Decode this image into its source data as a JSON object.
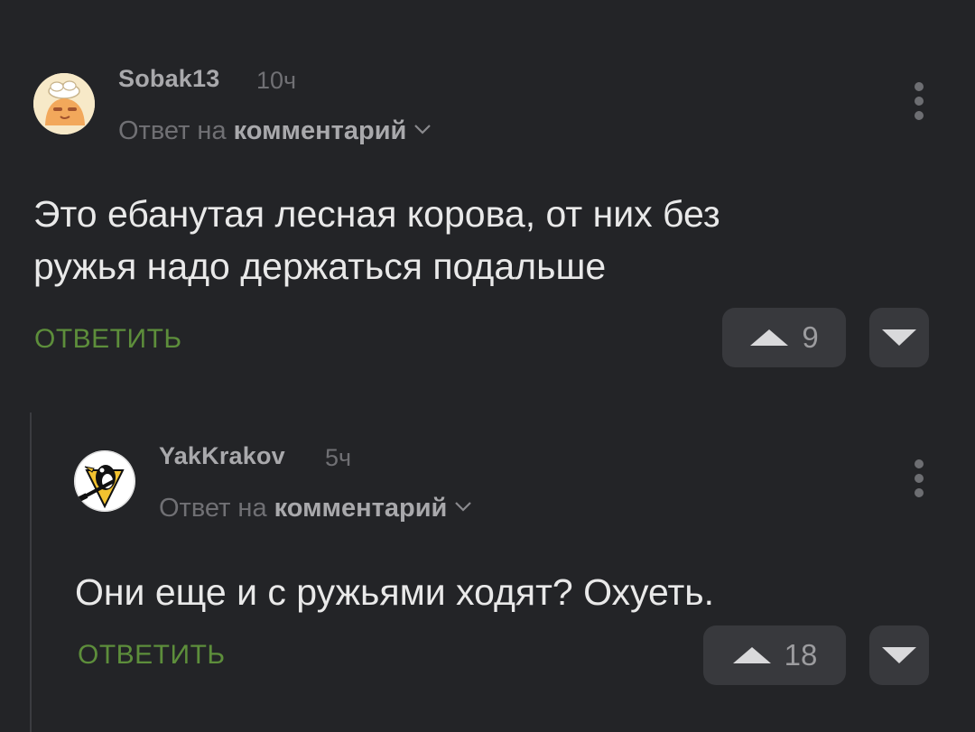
{
  "comments": [
    {
      "author": "Sobak13",
      "time": "10ч",
      "reply_to_prefix": "Ответ на",
      "reply_to_link": "комментарий",
      "text_line1": "Это ебанутая лесная корова, от них без",
      "text_line2": "ружья надо держаться подальше",
      "reply_label": "ОТВЕТИТЬ",
      "rating": "9"
    },
    {
      "author": "YakKrakov",
      "time": "5ч",
      "reply_to_prefix": "Ответ на",
      "reply_to_link": "комментарий",
      "text_line1": "Они еще и с ружьями ходят? Охуеть.",
      "reply_label": "ОТВЕТИТЬ",
      "rating": "18"
    }
  ],
  "icons": {
    "upvote": "triangle-up-icon",
    "downvote": "triangle-down-icon",
    "menu": "vertical-dots-icon",
    "expand": "chevron-down-icon"
  },
  "colors": {
    "background": "#232427",
    "reply_action": "#5d8e3b",
    "vote_button": "#38393d"
  }
}
